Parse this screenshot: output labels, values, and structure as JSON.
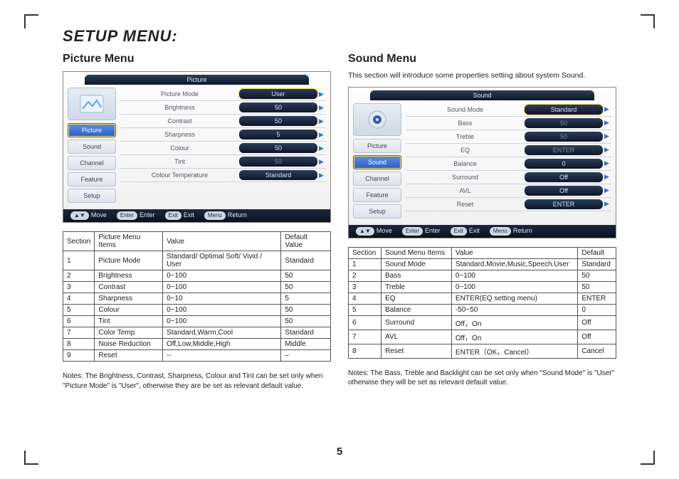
{
  "title": "SETUP MENU:",
  "page_number": "5",
  "picture": {
    "heading": "Picture Menu",
    "osd_title": "Picture",
    "nav": [
      "Picture",
      "Sound",
      "Channel",
      "Feature",
      "Setup"
    ],
    "nav_active": "Picture",
    "props": [
      {
        "label": "Picture Mode",
        "value": "User",
        "highlight": true
      },
      {
        "label": "Brightness",
        "value": "50"
      },
      {
        "label": "Contrast",
        "value": "50"
      },
      {
        "label": "Sharpness",
        "value": "5"
      },
      {
        "label": "Colour",
        "value": "50"
      },
      {
        "label": "Tint",
        "value": "50",
        "dim": true
      },
      {
        "label": "Colour Temperature",
        "value": "Standard"
      }
    ],
    "footer": {
      "move": "Move",
      "enter_key": "Enter",
      "enter": "Enter",
      "exit_key": "Exit",
      "exit": "Exit",
      "menu_key": "Menu",
      "return": "Return"
    },
    "table_headers": [
      "Section",
      "Picture Menu Items",
      "Value",
      "Default Value"
    ],
    "table_rows": [
      [
        "1",
        "Picture Mode",
        "Standard/ Optimal Soft/ Vivid / User",
        "Standard"
      ],
      [
        "2",
        "Brightness",
        "0~100",
        "50"
      ],
      [
        "3",
        "Contrast",
        "0~100",
        "50"
      ],
      [
        "4",
        "Sharpness",
        "0~10",
        "5"
      ],
      [
        "5",
        "Colour",
        "0~100",
        "50"
      ],
      [
        "6",
        "Tint",
        "0~100",
        "50"
      ],
      [
        "7",
        "Color Temp",
        "Standard,Warm,Cool",
        "Standard"
      ],
      [
        "8",
        "Noise Reduction",
        "Off,Low,Middle,High",
        "Middle"
      ],
      [
        "9",
        "Reset",
        "--",
        "–"
      ]
    ],
    "notes": "Notes: The Brightness, Contrast, Sharpness, Colour and Tint can be set only when \"Picture Mode\" is \"User\", otherwise they are be set as relevant default value."
  },
  "sound": {
    "heading": "Sound Menu",
    "intro": "This section will introduce some properties setting about system Sound.",
    "osd_title": "Sound",
    "nav": [
      "Picture",
      "Sound",
      "Channel",
      "Feature",
      "Setup"
    ],
    "nav_active": "Sound",
    "props": [
      {
        "label": "Sound Mode",
        "value": "Standard",
        "highlight": true
      },
      {
        "label": "Bass",
        "value": "50",
        "dim": true
      },
      {
        "label": "Treble",
        "value": "50",
        "dim": true
      },
      {
        "label": "EQ",
        "value": "ENTER",
        "dim": true
      },
      {
        "label": "Balance",
        "value": "0"
      },
      {
        "label": "Surround",
        "value": "Off"
      },
      {
        "label": "AVL",
        "value": "Off"
      },
      {
        "label": "Reset",
        "value": "ENTER"
      }
    ],
    "footer": {
      "move": "Move",
      "enter_key": "Enter",
      "enter": "Enter",
      "exit_key": "Exit",
      "exit": "Exit",
      "menu_key": "Menu",
      "return": "Return"
    },
    "table_headers": [
      "Section",
      "Sound Menu Items",
      "Value",
      "Default"
    ],
    "table_rows": [
      [
        "1",
        "Sound Mode",
        "Standard,Movie,Music,Speech,User",
        "Standard"
      ],
      [
        "2",
        "Bass",
        "0~100",
        "50"
      ],
      [
        "3",
        "Treble",
        "0~100",
        "50"
      ],
      [
        "4",
        "EQ",
        "ENTER(EQ setting menu)",
        "ENTER"
      ],
      [
        "5",
        "Balance",
        "-50~50",
        "0"
      ],
      [
        "6",
        "Surround",
        "Off，On",
        "Off"
      ],
      [
        "7",
        "AVL",
        "Off，On",
        "Off"
      ],
      [
        "8",
        "Reset",
        "ENTER（OK，Cancel）",
        "Cancel"
      ]
    ],
    "notes": "Notes: The Bass, Treble and Backlight can be set only when \"Sound Mode\" is \"User\" otherwise they will be set as relevant default value."
  }
}
